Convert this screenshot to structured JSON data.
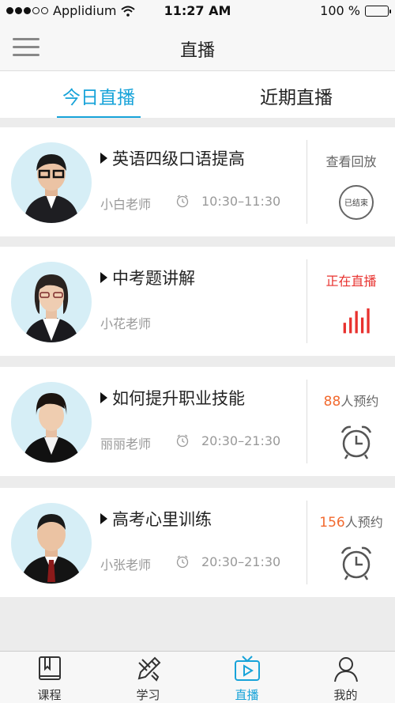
{
  "status_bar": {
    "carrier": "Applidium",
    "time": "11:27 AM",
    "battery": "100 %"
  },
  "nav": {
    "title": "直播"
  },
  "tabs": [
    {
      "label": "今日直播",
      "active": true
    },
    {
      "label": "近期直播",
      "active": false
    }
  ],
  "lives": [
    {
      "title": "英语四级口语提高",
      "teacher": "小白老师",
      "time": "10:30–11:30",
      "status": "查看回放",
      "badge": "已结束"
    },
    {
      "title": "中考题讲解",
      "teacher": "小花老师",
      "status": "正在直播"
    },
    {
      "title": "如何提升职业技能",
      "teacher": "丽丽老师",
      "time": "20:30–21:30",
      "count": "88",
      "count_suffix": "人预约"
    },
    {
      "title": "高考心里训练",
      "teacher": "小张老师",
      "time": "20:30–21:30",
      "count": "156",
      "count_suffix": "人预约"
    }
  ],
  "tabbar": [
    {
      "label": "课程",
      "icon": "book-icon"
    },
    {
      "label": "学习",
      "icon": "pencil-icon"
    },
    {
      "label": "直播",
      "icon": "tv-play-icon",
      "active": true
    },
    {
      "label": "我的",
      "icon": "person-icon"
    }
  ],
  "colors": {
    "accent": "#17a3d9",
    "live_red": "#e8312e",
    "count_orange": "#f26a2f"
  }
}
